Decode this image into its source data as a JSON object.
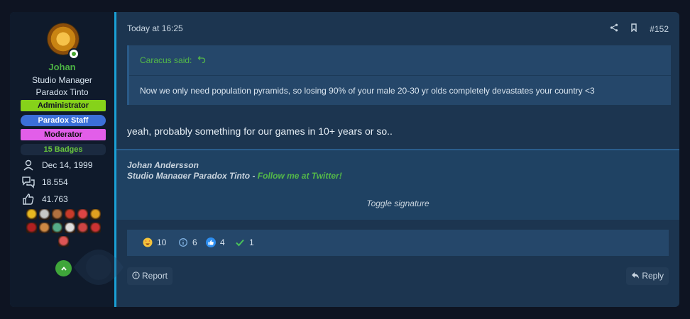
{
  "user": {
    "username": "Johan",
    "title_line1": "Studio Manager",
    "title_line2": "Paradox Tinto",
    "banners": [
      "Administrator",
      "Paradox Staff",
      "Moderator"
    ],
    "badges_label": "15 Badges",
    "stats": {
      "joined": "Dec 14, 1999",
      "messages": "18.554",
      "reactions": "41.763"
    },
    "trophy_colors": [
      "#e8b820",
      "#c7c7c7",
      "#b07040",
      "#c83a2a",
      "#d44",
      "#e0a020",
      "#b02020",
      "#c84",
      "#5a8",
      "#ddd",
      "#c44",
      "#c33",
      "#d55"
    ]
  },
  "post": {
    "date": "Today at 16:25",
    "number": "#152",
    "quote": {
      "author_line": "Caracus said:",
      "text": "Now we only need population pyramids, so losing 90% of your male 20-30 yr olds completely devastates your country <3"
    },
    "message": "yeah, probably something for our games in 10+ years or so..",
    "signature": {
      "name": "Johan Andersson",
      "line_prefix": "Studio Manager Paradox Tinto - ",
      "link_text": "Follow me at Twitter!",
      "toggle": "Toggle signature"
    },
    "reactions": [
      {
        "icon": "star-struck-icon",
        "count": "10"
      },
      {
        "icon": "info-icon",
        "count": "6"
      },
      {
        "icon": "thumbs-up-icon",
        "count": "4"
      },
      {
        "icon": "checkmark-icon",
        "count": "1"
      }
    ],
    "report_label": "Report",
    "reply_label": "Reply"
  },
  "colors": {
    "accent_green": "#54b948",
    "left_border": "#1aa0d6"
  }
}
